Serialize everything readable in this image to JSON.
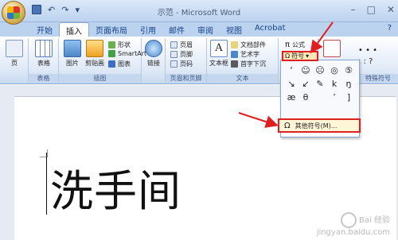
{
  "window": {
    "title": "示范 - Microsoft Word",
    "controls": [
      "–",
      "□",
      "✕"
    ]
  },
  "quick_access": [
    "save-icon",
    "undo-icon",
    "redo-icon"
  ],
  "tabs": [
    {
      "label": "开始"
    },
    {
      "label": "插入"
    },
    {
      "label": "页面布局"
    },
    {
      "label": "引用"
    },
    {
      "label": "邮件"
    },
    {
      "label": "审阅"
    },
    {
      "label": "视图"
    },
    {
      "label": "Acrobat"
    }
  ],
  "tab_help": "?",
  "ribbon": {
    "pages": {
      "label": "页",
      "group": ""
    },
    "table": {
      "label": "表格",
      "group": "表格"
    },
    "illustrations": {
      "picture": "图片",
      "clipart": "剪贴画",
      "shapes": "形状",
      "smartart": "SmartArt",
      "chart": "图表",
      "group": "插图"
    },
    "links": {
      "label": "链接"
    },
    "header_footer": {
      "header": "页眉",
      "footer": "页脚",
      "page_number": "页码",
      "group": "页眉和页脚"
    },
    "text": {
      "textbox": "文本框",
      "quickparts": "文档部件",
      "wordart": "艺术字",
      "dropcap": "首字下沉",
      "group": "文本"
    },
    "symbols": {
      "equation": "公式",
      "symbol": "符号",
      "group": "特殊符号"
    }
  },
  "symbol_panel": {
    "symbols": [
      "‘",
      "☺",
      "☹",
      "◎",
      "⑤",
      "↘",
      "↙",
      "✎",
      "k",
      "ŋ",
      "æ",
      "θ",
      "",
      "’",
      "]"
    ],
    "more_label": "其他符号(M)..."
  },
  "document": {
    "text": "洗手间"
  },
  "watermark": {
    "line1": "Bai 经验",
    "line2": "jingyan.baidu.com"
  },
  "colors": {
    "accent_red": "#e02020",
    "ribbon_blue": "#bcd3ef",
    "tab_text": "#15428b"
  }
}
